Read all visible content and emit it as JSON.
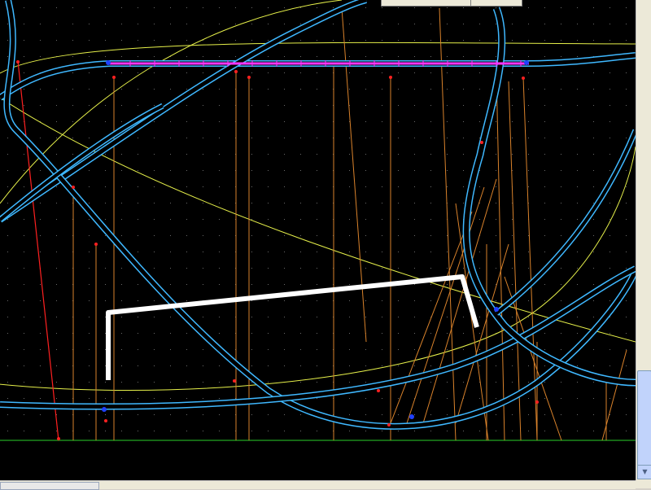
{
  "colors": {
    "background": "#000000",
    "track": "#3fb8ff",
    "guide_curve": "#e6f04a",
    "support": "#d9822b",
    "selected_segment": "#ff33ff",
    "ground": "#1c8a1c",
    "drawn_path": "#ffffff",
    "node_red": "#ff2020",
    "node_blue": "#2040ff",
    "grid_dot": "#6a6a6a"
  },
  "icons": {
    "scroll_down": "arrow-down-icon"
  }
}
